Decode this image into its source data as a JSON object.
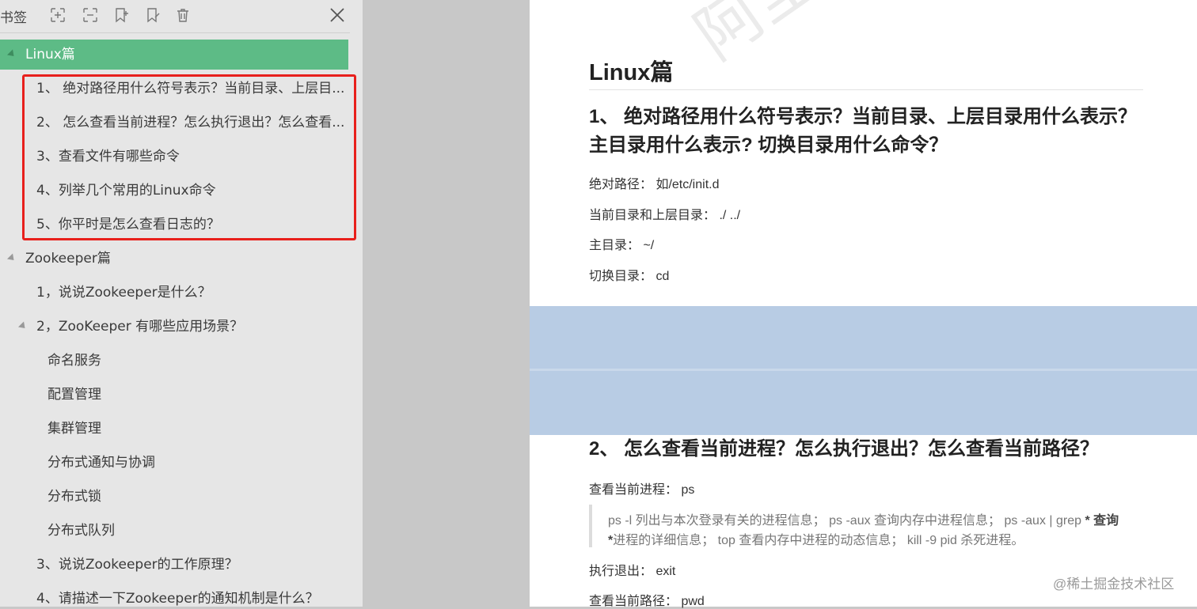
{
  "sidebar": {
    "title": "书签",
    "toolbar": {
      "expand_icon": "expand-all-icon",
      "collapse_icon": "collapse-all-icon",
      "add_bookmark_icon": "add-bookmark-icon",
      "edit_bookmark_icon": "edit-bookmark-icon",
      "delete_icon": "trash-icon",
      "close_icon": "close-icon"
    },
    "tree": [
      {
        "label": "Linux篇",
        "level": 0,
        "expanded": true,
        "selected": true
      },
      {
        "label": "1、 绝对路径用什么符号表示？当前目录、上层目...",
        "level": 1
      },
      {
        "label": "2、 怎么查看当前进程？怎么执行退出？怎么查看...",
        "level": 1
      },
      {
        "label": "3、查看文件有哪些命令",
        "level": 1
      },
      {
        "label": "4、列举几个常用的Linux命令",
        "level": 1
      },
      {
        "label": "5、你平时是怎么查看日志的？",
        "level": 1
      },
      {
        "label": "Zookeeper篇",
        "level": 0,
        "expanded": true
      },
      {
        "label": "1，说说Zookeeper是什么？",
        "level": 1
      },
      {
        "label": "2，ZooKeeper 有哪些应用场景？",
        "level": 1,
        "expanded": true
      },
      {
        "label": "命名服务",
        "level": 2
      },
      {
        "label": "配置管理",
        "level": 2
      },
      {
        "label": "集群管理",
        "level": 2
      },
      {
        "label": "分布式通知与协调",
        "level": 2
      },
      {
        "label": "分布式锁",
        "level": 2
      },
      {
        "label": "分布式队列",
        "level": 2
      },
      {
        "label": "3、说说Zookeeper的工作原理？",
        "level": 1
      },
      {
        "label": "4、请描述一下Zookeeper的通知机制是什么？",
        "level": 1
      }
    ]
  },
  "document": {
    "watermark": "阿里",
    "h1": "Linux篇",
    "q1_line1": "1、 绝对路径用什么符号表示？当前目录、上层目录用什么表示？",
    "q1_line2": "主目录用什么表示? 切换目录用什么命令？",
    "q1_answers": [
      "绝对路径： 如/etc/init.d",
      "当前目录和上层目录： ./ ../",
      "主目录： ~/",
      "切换目录： cd"
    ],
    "q2": "2、 怎么查看当前进程？怎么执行退出？怎么查看当前路径？",
    "q2_p1": "查看当前进程： ps",
    "quote_line1_pre": "ps -l 列出与本次登录有关的进程信息； ps -aux 查询内存中进程信息； ps -aux | grep ",
    "quote_line1_bold": "* 查询",
    "quote_line2_bold": "*",
    "quote_line2": "进程的详细信息； top 查看内存中进程的动态信息； kill -9 pid 杀死进程。",
    "q2_p2": "执行退出： exit",
    "q2_p3": "查看当前路径： pwd"
  },
  "site_mark": "@稀土掘金技术社区",
  "colors": {
    "sidebar_bg": "#e6e6e6",
    "selected": "#5dbb86",
    "highlight_border": "#e8201c",
    "page_gap": "#b8cce4"
  }
}
